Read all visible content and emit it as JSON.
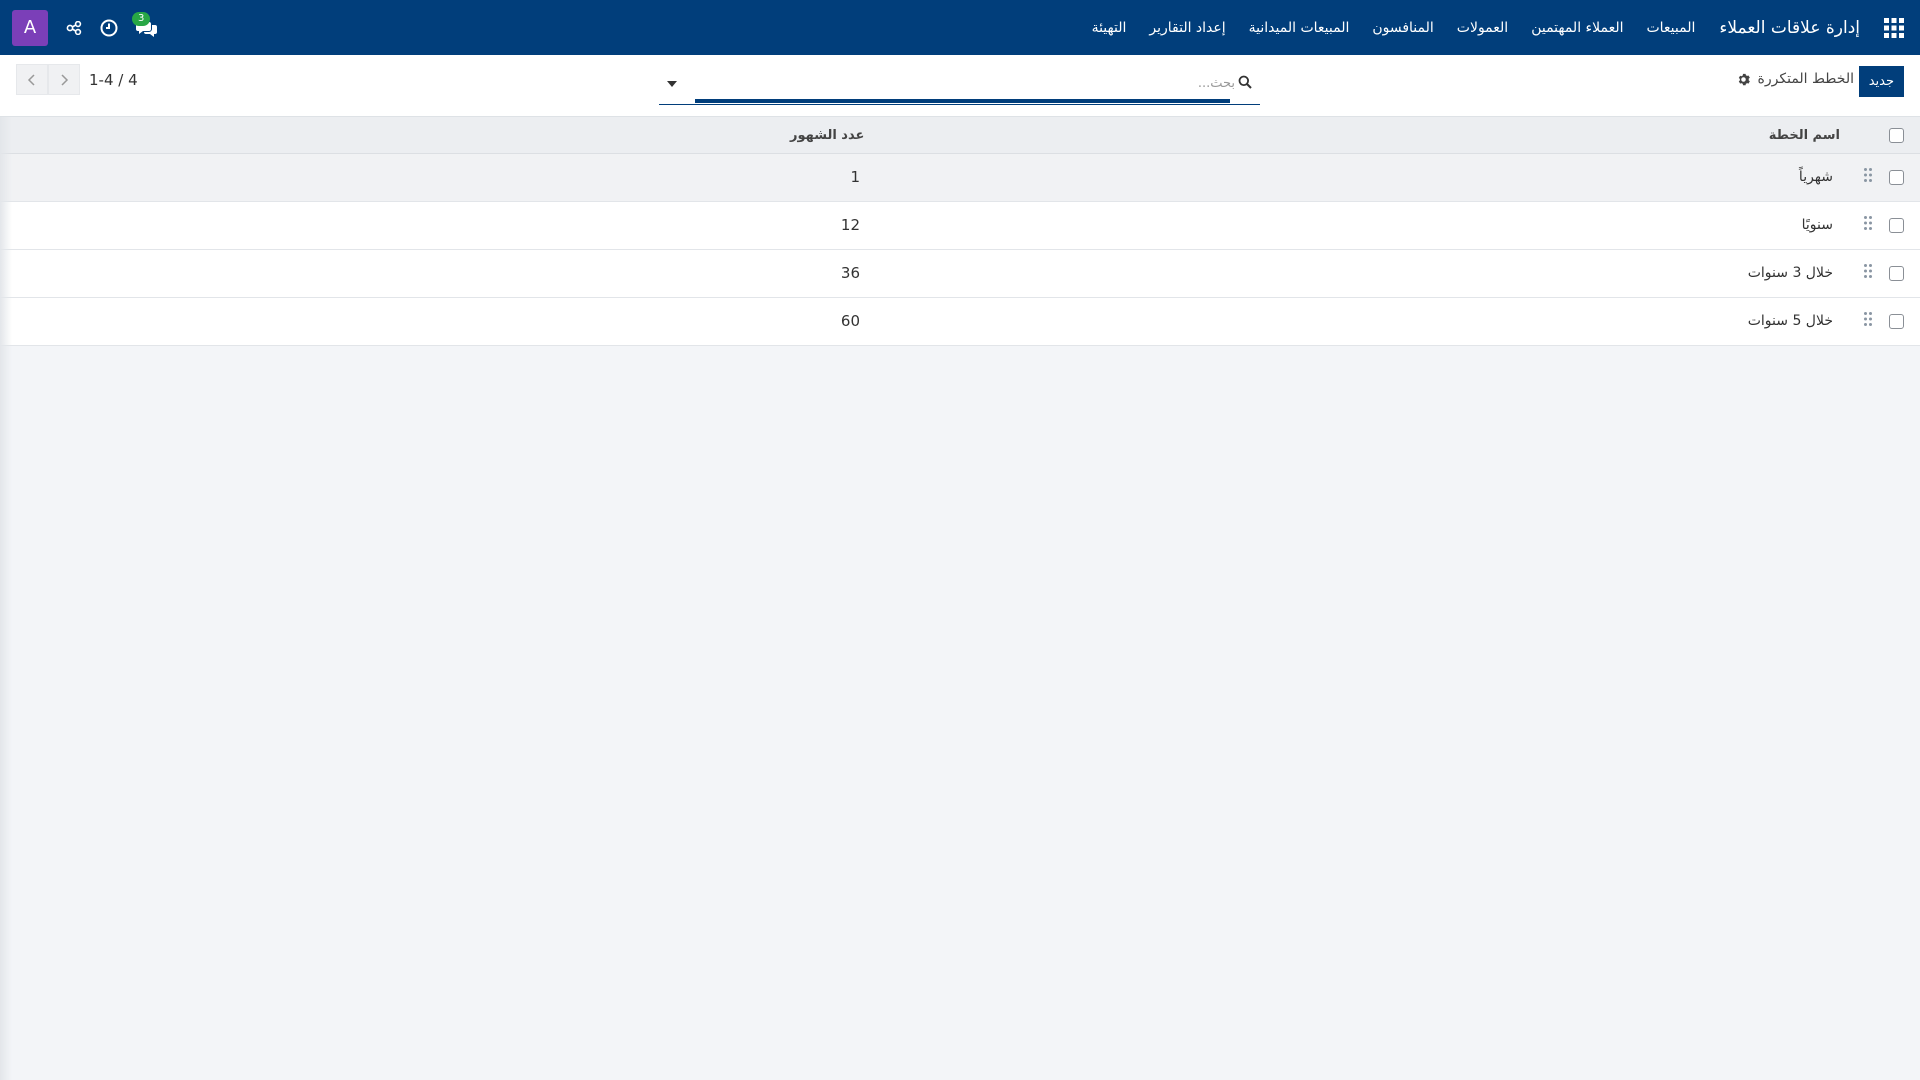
{
  "navbar": {
    "brand": "إدارة علاقات العملاء",
    "menu": [
      "المبيعات",
      "العملاء المهتمين",
      "العمولات",
      "المنافسون",
      "المبيعات الميدانية",
      "إعداد التقارير",
      "التهيئة"
    ],
    "chat_badge": "3",
    "avatar_letter": "A",
    "icons": [
      "apps-grid-icon",
      "chat-icon",
      "clock-icon",
      "share-icon"
    ],
    "bg_color": "#013e7b",
    "avatar_color": "#7b3fb8",
    "badge_color": "#28a745"
  },
  "control_panel": {
    "new_button": "جديد",
    "breadcrumb": "الخطط المتكررة",
    "search": {
      "placeholder": "بحث...",
      "value": ""
    },
    "pager": "1-4 / 4"
  },
  "table": {
    "columns": [
      "اسم الخطة",
      "عدد الشهور"
    ],
    "rows": [
      {
        "name": "شهرياً",
        "months": "1"
      },
      {
        "name": "سنويًا",
        "months": "12"
      },
      {
        "name": "خلال 3 سنوات",
        "months": "36"
      },
      {
        "name": "خلال 5 سنوات",
        "months": "60"
      }
    ]
  }
}
